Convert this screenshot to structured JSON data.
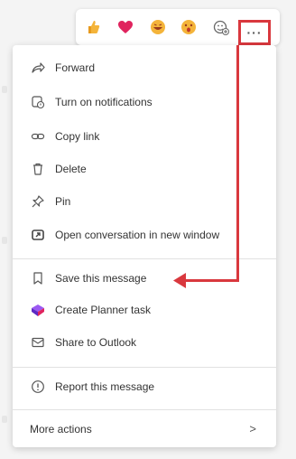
{
  "reactions": [
    {
      "icon": "like-emoji-icon",
      "color": "#f4b43a"
    },
    {
      "icon": "heart-emoji-icon",
      "color": "#e0245e"
    },
    {
      "icon": "laugh-emoji-icon",
      "color": "#f4b43a"
    },
    {
      "icon": "surprised-emoji-icon",
      "color": "#f4b43a"
    },
    {
      "icon": "add-reaction-icon",
      "color": "#666666"
    }
  ],
  "more_options": {
    "label": "···",
    "icon": "more-options-icon"
  },
  "menu": {
    "items": [
      {
        "label": "Forward",
        "icon": "forward-icon"
      },
      {
        "label": "Turn on notifications",
        "icon": "notification-icon"
      },
      {
        "label": "Copy link",
        "icon": "link-icon"
      },
      {
        "label": "Delete",
        "icon": "trash-icon"
      },
      {
        "label": "Pin",
        "icon": "pin-icon"
      },
      {
        "label": "Open conversation in new window",
        "icon": "pop-out-icon"
      },
      {
        "label": "Save this message",
        "icon": "bookmark-icon"
      },
      {
        "label": "Create Planner task",
        "icon": "planner-icon"
      },
      {
        "label": "Share to Outlook",
        "icon": "outlook-mail-icon"
      },
      {
        "label": "Report this message",
        "icon": "report-icon"
      },
      {
        "label": "More actions",
        "icon": "chevron-right-icon"
      }
    ],
    "more_actions_chevron": ">"
  },
  "colors": {
    "annotation": "#d9383e",
    "planner": "#7b3fe4"
  }
}
